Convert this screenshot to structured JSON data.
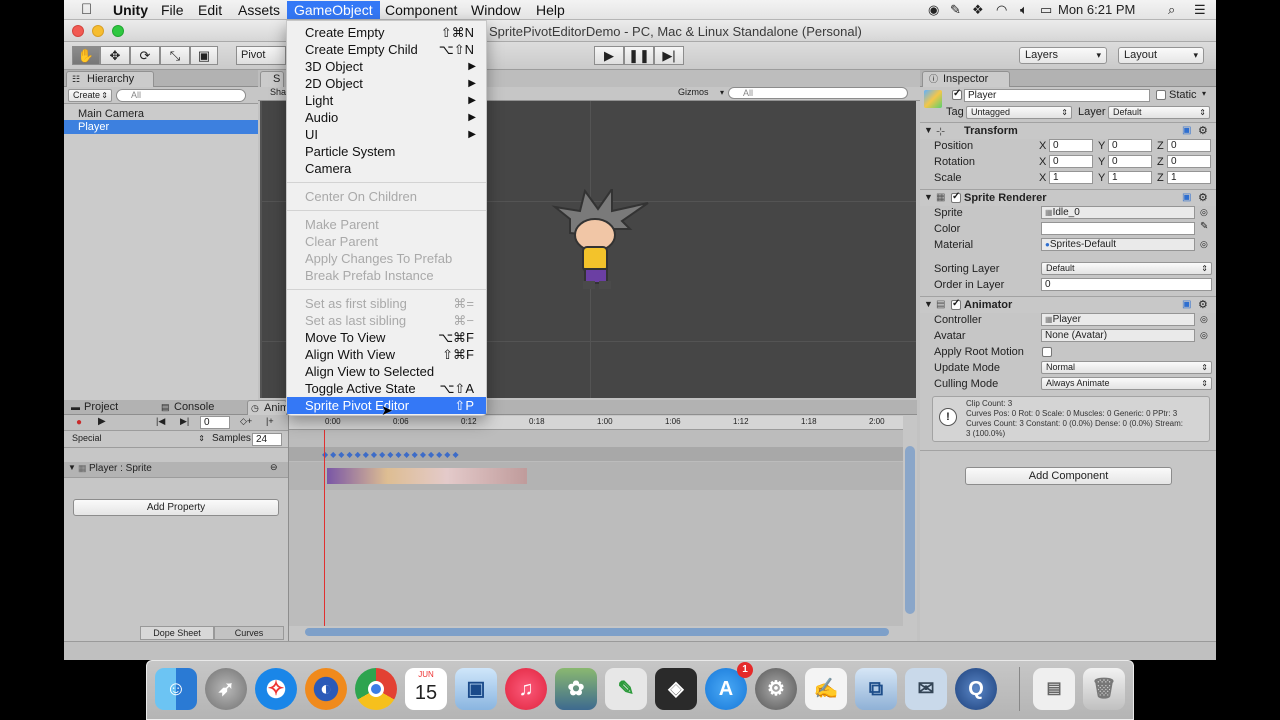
{
  "menubar": {
    "app_name": "Unity",
    "items": [
      "File",
      "Edit",
      "Assets",
      "GameObject",
      "Component",
      "Window",
      "Help"
    ],
    "active_item": "GameObject",
    "clock": "Mon 6:21 PM"
  },
  "window": {
    "title": "SpritePivotEditorDemo - PC, Mac & Linux Standalone (Personal)"
  },
  "toolbar": {
    "pivot_label": "Pivot",
    "layers_label": "Layers",
    "layout_label": "Layout"
  },
  "gameobject_menu": {
    "items": [
      {
        "label": "Create Empty",
        "shortcut": "⇧⌘N",
        "enabled": true
      },
      {
        "label": "Create Empty Child",
        "shortcut": "⌥⇧N",
        "enabled": true
      },
      {
        "label": "3D Object",
        "submenu": true,
        "enabled": true
      },
      {
        "label": "2D Object",
        "submenu": true,
        "enabled": true
      },
      {
        "label": "Light",
        "submenu": true,
        "enabled": true
      },
      {
        "label": "Audio",
        "submenu": true,
        "enabled": true
      },
      {
        "label": "UI",
        "submenu": true,
        "enabled": true
      },
      {
        "label": "Particle System",
        "enabled": true
      },
      {
        "label": "Camera",
        "enabled": true
      },
      {
        "label": "Center On Children",
        "enabled": false
      },
      {
        "label": "Make Parent",
        "enabled": false
      },
      {
        "label": "Clear Parent",
        "enabled": false
      },
      {
        "label": "Apply Changes To Prefab",
        "enabled": false
      },
      {
        "label": "Break Prefab Instance",
        "enabled": false
      },
      {
        "label": "Set as first sibling",
        "shortcut": "⌘=",
        "enabled": false
      },
      {
        "label": "Set as last sibling",
        "shortcut": "⌘−",
        "enabled": false
      },
      {
        "label": "Move To View",
        "shortcut": "⌥⌘F",
        "enabled": true
      },
      {
        "label": "Align With View",
        "shortcut": "⇧⌘F",
        "enabled": true
      },
      {
        "label": "Align View to Selected",
        "enabled": true
      },
      {
        "label": "Toggle Active State",
        "shortcut": "⌥⇧A",
        "enabled": true
      },
      {
        "label": "Sprite Pivot Editor",
        "shortcut": "⇧P",
        "enabled": true,
        "highlighted": true
      }
    ]
  },
  "hierarchy": {
    "tab": "Hierarchy",
    "create_label": "Create",
    "search_placeholder": "All",
    "items": [
      "Main Camera",
      "Player"
    ],
    "selected": "Player"
  },
  "scene": {
    "tab_label": "S",
    "shading_label": "Sha",
    "gizmos_label": "Gizmos",
    "search_placeholder": "All"
  },
  "inspector": {
    "tab": "Inspector",
    "object_name": "Player",
    "static_label": "Static",
    "tag_label": "Tag",
    "tag_value": "Untagged",
    "layer_label": "Layer",
    "layer_value": "Default",
    "transform": {
      "title": "Transform",
      "position": {
        "label": "Position",
        "x": "0",
        "y": "0",
        "z": "0"
      },
      "rotation": {
        "label": "Rotation",
        "x": "0",
        "y": "0",
        "z": "0"
      },
      "scale": {
        "label": "Scale",
        "x": "1",
        "y": "1",
        "z": "1"
      }
    },
    "sprite_renderer": {
      "title": "Sprite Renderer",
      "sprite_label": "Sprite",
      "sprite_value": "Idle_0",
      "color_label": "Color",
      "material_label": "Material",
      "material_value": "Sprites-Default",
      "sorting_layer_label": "Sorting Layer",
      "sorting_layer_value": "Default",
      "order_label": "Order in Layer",
      "order_value": "0"
    },
    "animator": {
      "title": "Animator",
      "controller_label": "Controller",
      "controller_value": "Player",
      "avatar_label": "Avatar",
      "avatar_value": "None (Avatar)",
      "root_motion_label": "Apply Root Motion",
      "update_mode_label": "Update Mode",
      "update_mode_value": "Normal",
      "culling_mode_label": "Culling Mode",
      "culling_mode_value": "Always Animate",
      "info_line1": "Clip Count: 3",
      "info_line2": "Curves Pos: 0 Rot: 0 Scale: 0 Muscles: 0 Generic: 0 PPtr: 3",
      "info_line3": "Curves Count: 3 Constant: 0 (0.0%) Dense: 0 (0.0%) Stream:",
      "info_line4": "3 (100.0%)"
    },
    "add_component_label": "Add Component"
  },
  "bottom_tabs": [
    "Project",
    "Console",
    "Anim"
  ],
  "animation": {
    "clip_label": "Special",
    "samples_label": "Samples",
    "samples_value": "24",
    "frame_value": "0",
    "property_label": "Player : Sprite",
    "add_property_label": "Add Property",
    "dope_sheet_label": "Dope Sheet",
    "curves_label": "Curves",
    "time_ticks": [
      "0:00",
      "0:06",
      "0:12",
      "0:18",
      "1:00",
      "1:06",
      "1:12",
      "1:18",
      "2:00"
    ]
  },
  "dock": {
    "apps": [
      "Finder",
      "Launchpad",
      "Safari",
      "Firefox",
      "Chrome",
      "Calendar",
      "Preview",
      "iTunes",
      "iPhoto",
      "Evernote",
      "Unity",
      "App Store",
      "System Preferences",
      "TextEdit",
      "Image Capture",
      "Mail",
      "QuickTime Player",
      "Documents",
      "Trash"
    ],
    "calendar_month": "JUN",
    "calendar_day": "15",
    "appstore_badge": "1"
  }
}
